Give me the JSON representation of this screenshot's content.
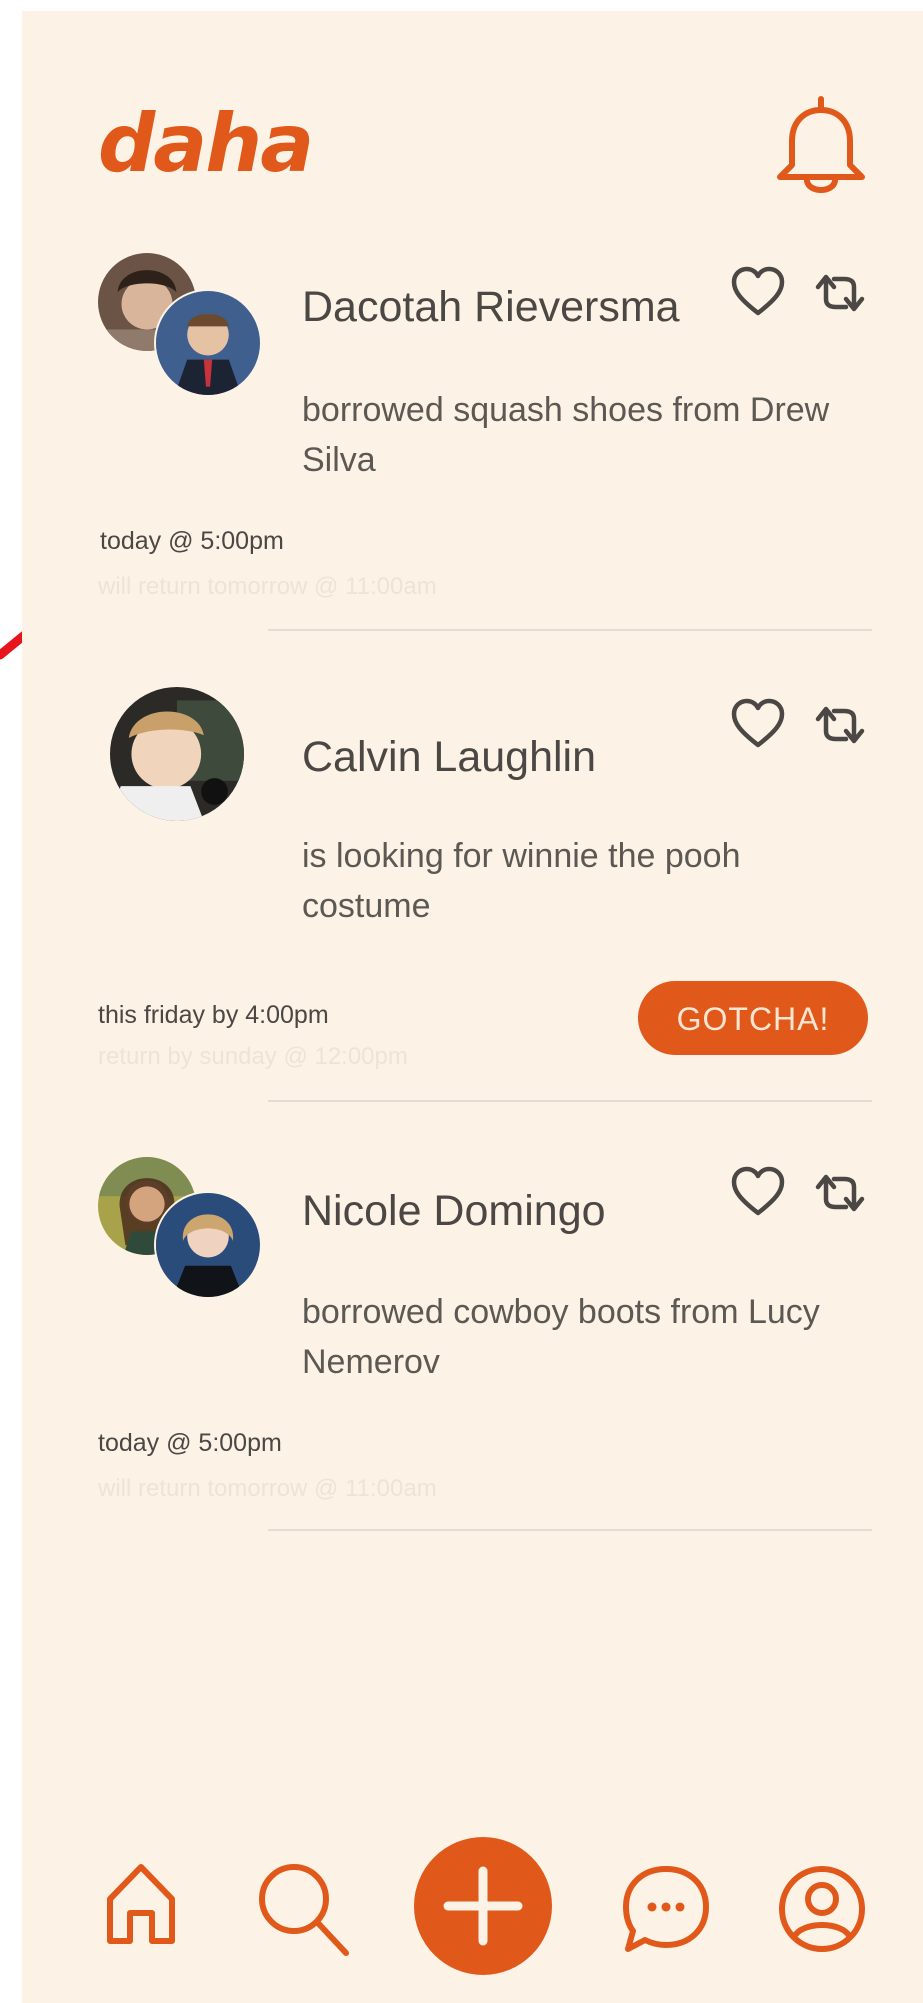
{
  "app": {
    "logo": "daha"
  },
  "colors": {
    "accent": "#e1591a",
    "background": "#fcf3e6",
    "text": "#4b4745",
    "annotation_arrow": "#e8141c"
  },
  "header": {
    "icon": "bell-icon"
  },
  "posts": [
    {
      "name": "Dacotah Rieversma",
      "description": "borrowed squash shoes from Drew Silva",
      "time": "today @ 5:00pm",
      "subtime": "will return tomorrow @ 11:00am",
      "avatar_count": 2
    },
    {
      "name": "Calvin Laughlin",
      "description": "is looking for winnie the pooh costume",
      "time": "this friday by 4:00pm",
      "subtime": "return by sunday @ 12:00pm",
      "action_label": "GOTCHA!",
      "avatar_count": 1
    },
    {
      "name": "Nicole Domingo",
      "description": "borrowed cowboy boots from Lucy Nemerov",
      "time": "today @ 5:00pm",
      "subtime": "will return tomorrow @ 11:00am",
      "avatar_count": 2
    }
  ],
  "post_actions": {
    "like_icon": "heart-icon",
    "repost_icon": "repost-icon"
  },
  "bottom_nav": {
    "items": [
      "home-icon",
      "search-icon",
      "plus-icon",
      "chat-icon",
      "profile-icon"
    ]
  }
}
